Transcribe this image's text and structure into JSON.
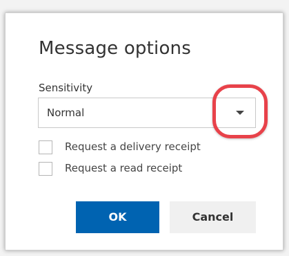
{
  "dialog": {
    "title": "Message options",
    "sensitivity": {
      "label": "Sensitivity",
      "selected_value": "Normal",
      "arrow_icon": "chevron-down-icon"
    },
    "checkboxes": [
      {
        "label": "Request a delivery receipt",
        "checked": false
      },
      {
        "label": "Request a read receipt",
        "checked": false
      }
    ],
    "buttons": {
      "ok_label": "OK",
      "cancel_label": "Cancel"
    },
    "colors": {
      "ok_button": "#0063b1",
      "highlight_ring": "#e8424a"
    }
  }
}
